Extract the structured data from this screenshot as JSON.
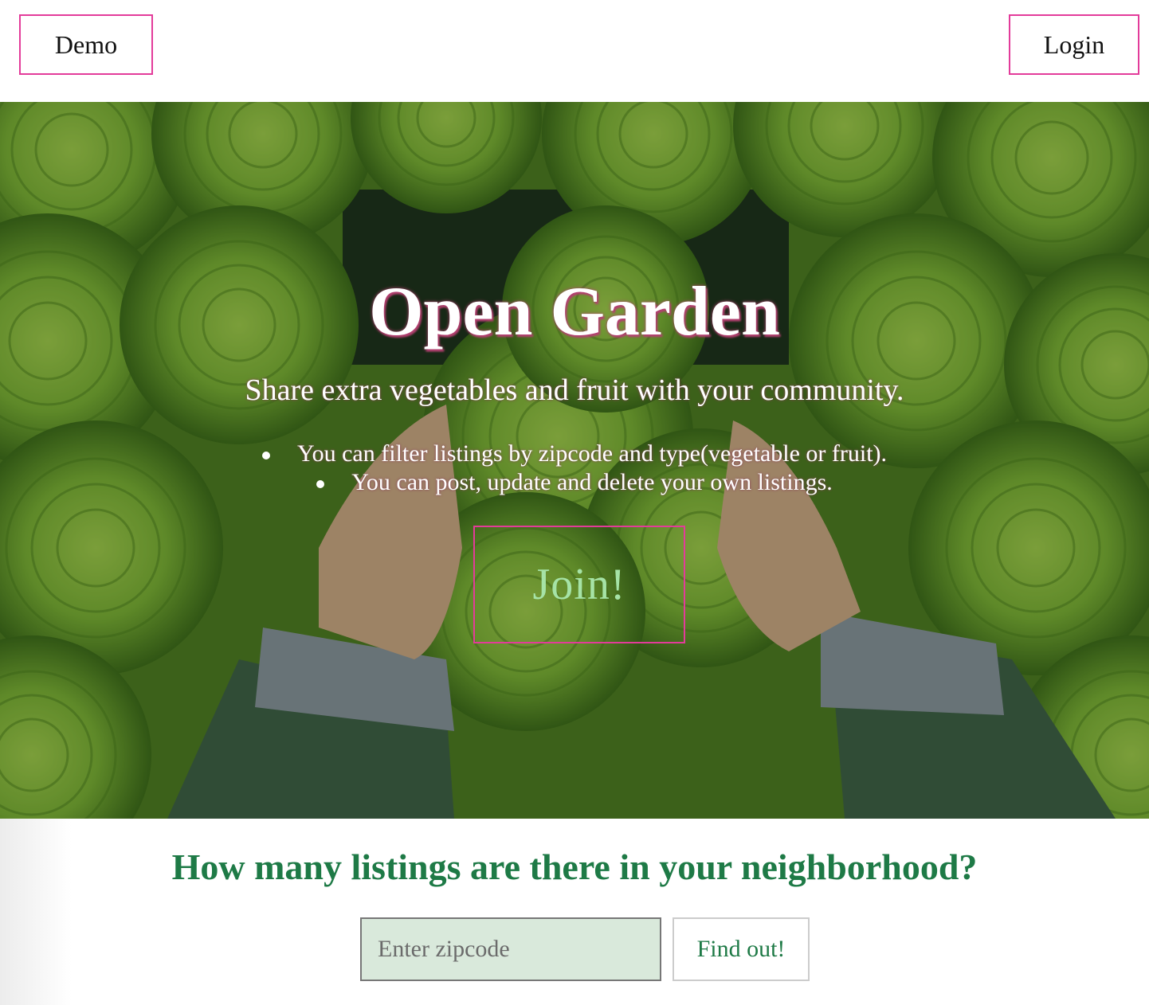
{
  "nav": {
    "demo_label": "Demo",
    "login_label": "Login"
  },
  "hero": {
    "title": "Open Garden",
    "subtitle": "Share extra vegetables and fruit with your community.",
    "features": [
      "You can filter listings by zipcode and type(vegetable or fruit).",
      "You can post, update and delete your own listings."
    ],
    "join_label": "Join!",
    "background": "lettuce-photo"
  },
  "search": {
    "question": "How many listings are there in your neighborhood?",
    "placeholder": "Enter zipcode",
    "button_label": "Find out!"
  },
  "colors": {
    "accent_border": "#e33b9a",
    "heading_green": "#1e7a46",
    "input_bg": "#d9e9db",
    "join_text": "#a6e3a6"
  }
}
